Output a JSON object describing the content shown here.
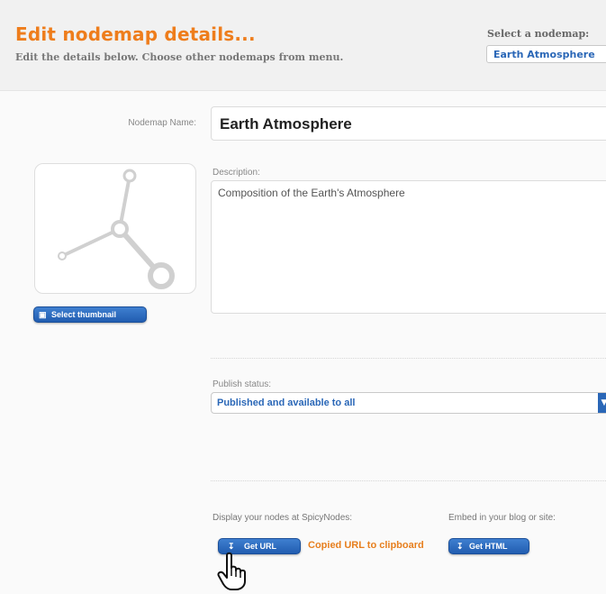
{
  "header": {
    "title": "Edit nodemap details...",
    "subtitle": "Edit the details below. Choose other nodemaps from menu.",
    "select_label": "Select a nodemap:",
    "select_value": "Earth Atmosphere"
  },
  "form": {
    "name_label": "Nodemap Name:",
    "name_value": "Earth Atmosphere",
    "description_label": "Description:",
    "description_value": "Composition of the Earth's Atmosphere",
    "select_thumbnail_label": "Select thumbnail",
    "publish_label": "Publish status:",
    "publish_value": "Published and available to all"
  },
  "share": {
    "display_label": "Display your nodes at SpicyNodes:",
    "get_url_label": "Get URL",
    "copied_message": "Copied URL to clipboard",
    "embed_label": "Embed in your blog or site:",
    "get_html_label": "Get HTML"
  },
  "colors": {
    "accent_orange": "#ee7d1c",
    "button_blue": "#2a67b7"
  },
  "icons": {
    "thumbnail": "node-graph-icon",
    "select_thumbnail": "image-icon",
    "get_url": "download-icon",
    "get_html": "download-icon",
    "cursor": "hand-pointer-icon",
    "dropdown": "chevron-down-icon"
  }
}
